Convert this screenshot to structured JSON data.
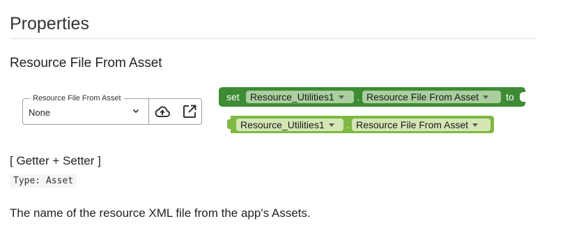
{
  "page": {
    "heading": "Properties"
  },
  "property": {
    "title": "Resource File From Asset",
    "widget_label": "Resource File From Asset",
    "value": "None",
    "icons": [
      "chevron-down-icon",
      "cloud-upload-icon",
      "open-in-new-icon"
    ],
    "kind": "[ Getter + Setter ]",
    "type": "Type: Asset",
    "description": "The name of the resource XML file from the app's Assets."
  },
  "blocks": {
    "setter": {
      "set_label": "set",
      "component": "Resource_Utilities1",
      "dot": ".",
      "property": "Resource File From Asset",
      "to_label": "to",
      "color": "#3d8b35"
    },
    "getter": {
      "component": "Resource_Utilities1",
      "dot": ".",
      "property": "Resource File From Asset",
      "color": "#7fb843"
    }
  }
}
